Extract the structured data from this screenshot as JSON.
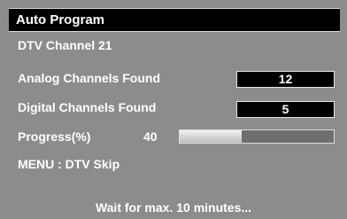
{
  "title": "Auto Program",
  "channel_label": "DTV Channel 21",
  "analog": {
    "label": "Analog Channels Found",
    "value": "12"
  },
  "digital": {
    "label": "Digital Channels Found",
    "value": "5"
  },
  "progress": {
    "label": "Progress(%)",
    "value": 40
  },
  "menu_hint": "MENU : DTV Skip",
  "footer": "Wait for max. 10 minutes..."
}
